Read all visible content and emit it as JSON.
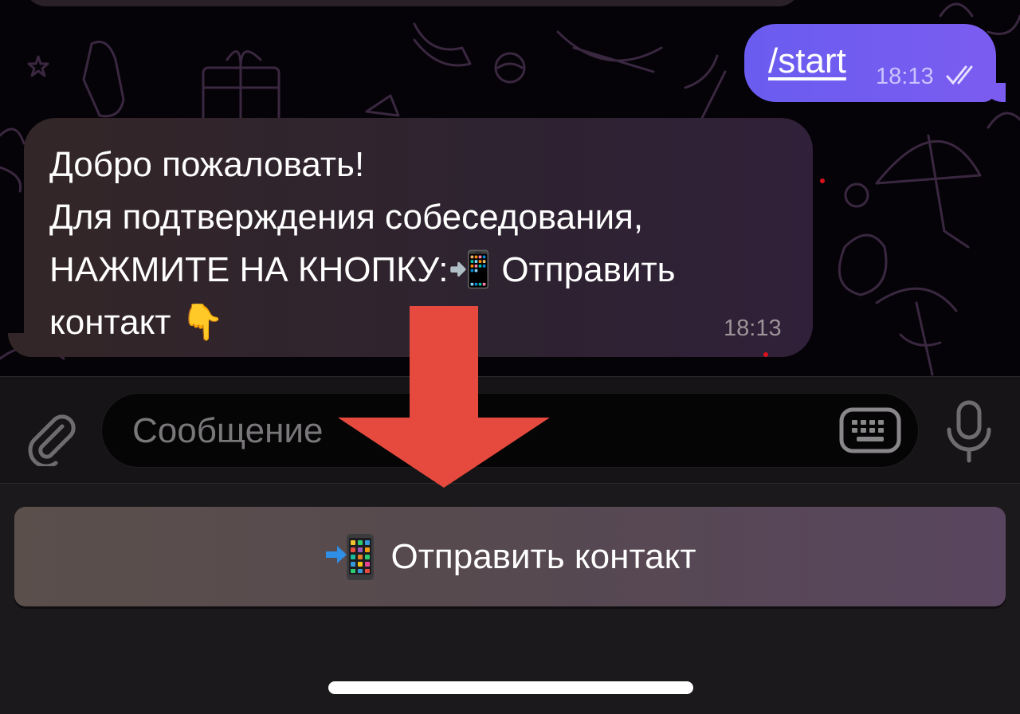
{
  "chat": {
    "outgoing": {
      "text": "/start",
      "time": "18:13",
      "status_icon": "double-check-icon"
    },
    "incoming": {
      "text": "Добро пожаловать!\nДля подтверждения собеседования,\nНАЖМИТЕ НА КНОПКУ:📲 Отправить\nконтакт 👇",
      "time": "18:13"
    }
  },
  "composer": {
    "placeholder": "Сообщение",
    "attach_icon": "paperclip-icon",
    "keyboard_icon": "keyboard-icon",
    "mic_icon": "microphone-icon"
  },
  "reply_keyboard": {
    "button_label": "Отправить контакт",
    "button_icon": "phone-with-arrow-icon"
  },
  "annotation": {
    "icon": "red-down-arrow",
    "color": "#e64a3f"
  },
  "colors": {
    "outgoing_bubble": "#6f5cf0",
    "incoming_bubble": "#302430",
    "background": "#050307",
    "doodle": "#3a2a4a"
  }
}
